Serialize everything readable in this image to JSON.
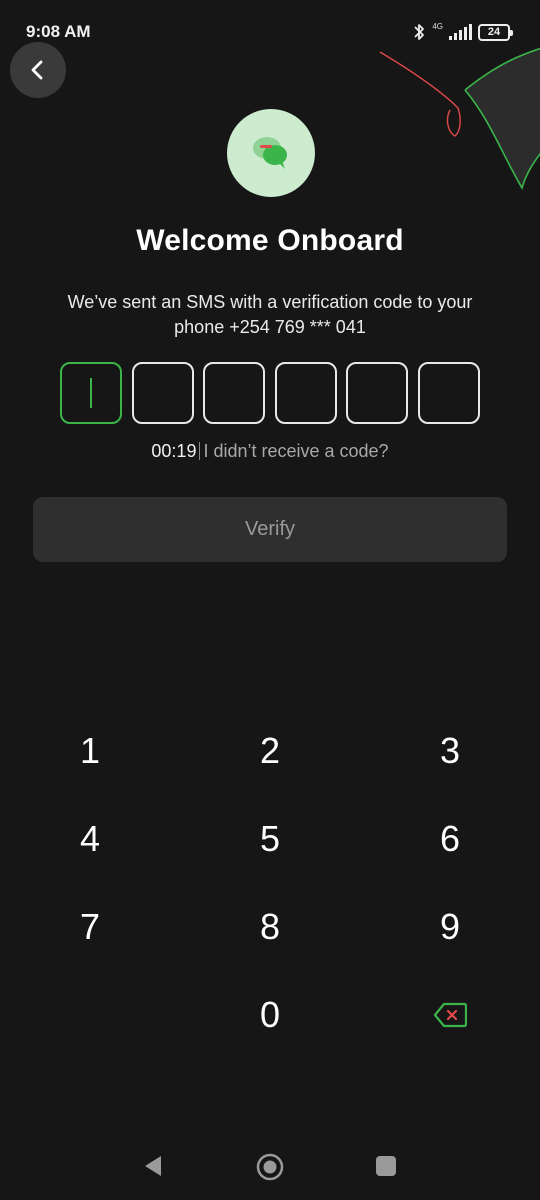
{
  "status_bar": {
    "time": "9:08 AM",
    "network": "4G",
    "battery": "24",
    "icons": [
      "bluetooth-icon",
      "signal-icon",
      "battery-icon"
    ]
  },
  "header": {
    "back_icon": "chevron-left-icon",
    "illustration_icon": "chat-bubbles-icon"
  },
  "main": {
    "title": "Welcome Onboard",
    "subtitle_line1": "We’ve sent an SMS with a verification code to your",
    "subtitle_line2": "phone +254 769 *** 041",
    "code_boxes": [
      "",
      "",
      "",
      "",
      "",
      ""
    ],
    "timer": "00:19",
    "resend_text": "I didn’t receive a code?",
    "verify_label": "Verify"
  },
  "keypad": {
    "keys": [
      "1",
      "2",
      "3",
      "4",
      "5",
      "6",
      "7",
      "8",
      "9",
      "0"
    ],
    "backspace_icon": "backspace-icon"
  },
  "nav_bar": {
    "icons": [
      "nav-back-icon",
      "nav-home-icon",
      "nav-recents-icon"
    ]
  },
  "colors": {
    "background": "#161616",
    "accent_green": "#3bb54a",
    "accent_red": "#e24a4a",
    "button_bg": "#2f2f2f",
    "illustration_bg": "#cdeccf"
  }
}
